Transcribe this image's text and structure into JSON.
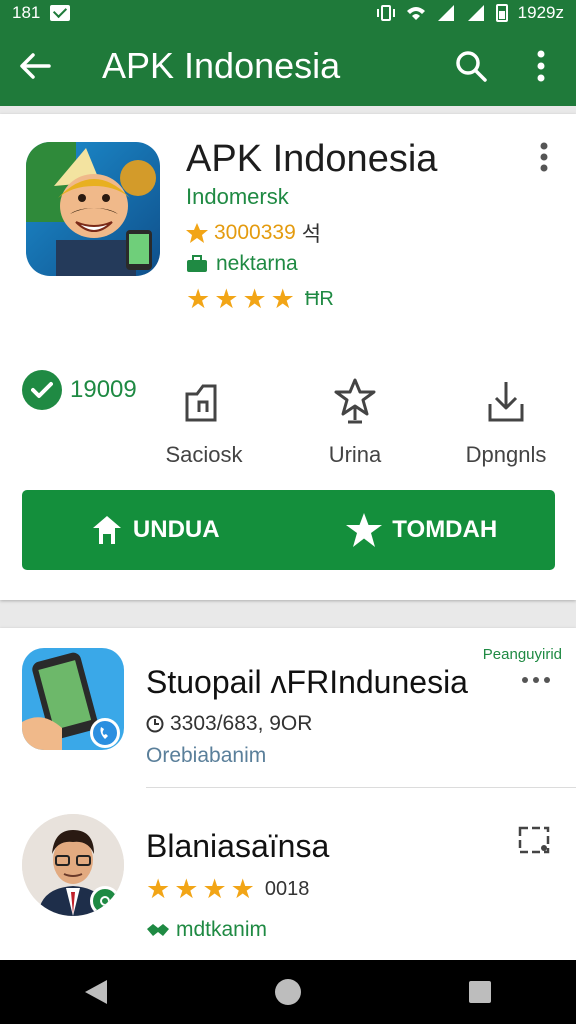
{
  "status_bar": {
    "time": "181",
    "battery": "1929z"
  },
  "app_bar": {
    "title": "APK Indonesia"
  },
  "app": {
    "name": "APK Indonesia",
    "developer": "Indomersk",
    "rating_value": "3000339",
    "rating_unit": "석",
    "tag": "nektarna",
    "review_count": "ĦR"
  },
  "stats": {
    "verified_count": "19009",
    "items": [
      {
        "label": "Saciosk",
        "icon": "share-icon"
      },
      {
        "label": "Urina",
        "icon": "trophy-icon"
      },
      {
        "label": "Dpngnls",
        "icon": "download-icon"
      }
    ]
  },
  "actions": {
    "download_label": "UNDUA",
    "favorite_label": "TOMDAH"
  },
  "list": {
    "item1": {
      "title": "Stuopail ʌFRIndunesia",
      "tag": "Peanguyirid",
      "meta": "3303/683, 9OR",
      "subtitle": "Orebiabanim"
    },
    "item2": {
      "title": "Blaniasaïnsa",
      "count": "0018",
      "subtitle": "mdtkanim"
    }
  },
  "colors": {
    "primary": "#1f7a3a",
    "accent": "#148f3c",
    "star": "#f2a516"
  }
}
